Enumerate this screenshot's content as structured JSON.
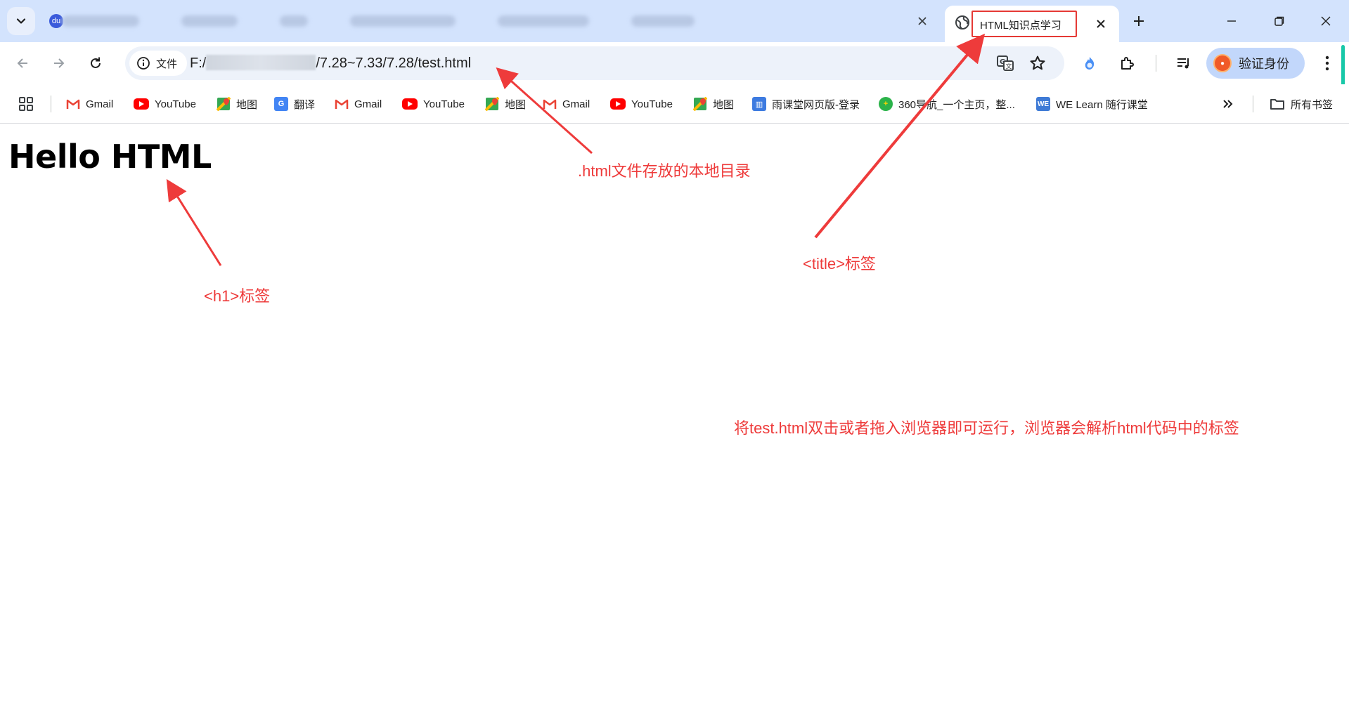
{
  "window": {
    "active_tab_title": "HTML知识点学习",
    "colors": {
      "tabstrip": "#d3e3fd",
      "annotation_red": "#ee3b3b",
      "omnibox": "#edf2fa"
    }
  },
  "toolbar": {
    "site_info_label": "文件",
    "url_prefix": "F:/",
    "url_suffix": "/7.28~7.33/7.28/test.html",
    "profile_label": "验证身份"
  },
  "bookmarks": [
    {
      "label": "Gmail",
      "icon": "gmail-icon"
    },
    {
      "label": "YouTube",
      "icon": "youtube-icon"
    },
    {
      "label": "地图",
      "icon": "maps-icon"
    },
    {
      "label": "翻译",
      "icon": "translate-icon"
    },
    {
      "label": "Gmail",
      "icon": "gmail-icon"
    },
    {
      "label": "YouTube",
      "icon": "youtube-icon"
    },
    {
      "label": "地图",
      "icon": "maps-icon"
    },
    {
      "label": "Gmail",
      "icon": "gmail-icon"
    },
    {
      "label": "YouTube",
      "icon": "youtube-icon"
    },
    {
      "label": "地图",
      "icon": "maps-icon"
    },
    {
      "label": "雨课堂网页版-登录",
      "icon": "rain-classroom-icon"
    },
    {
      "label": "360导航_一个主页，整...",
      "icon": "360-icon"
    },
    {
      "label": "WE Learn 随行课堂",
      "icon": "welearn-icon"
    }
  ],
  "bookmarks_folder": "所有书签",
  "page": {
    "heading": "Hello HTML"
  },
  "annotations": {
    "url_note": ".html文件存放的本地目录",
    "title_note": "<title>标签",
    "h1_note": "<h1>标签",
    "run_note": "将test.html双击或者拖入浏览器即可运行，浏览器会解析html代码中的标签"
  }
}
